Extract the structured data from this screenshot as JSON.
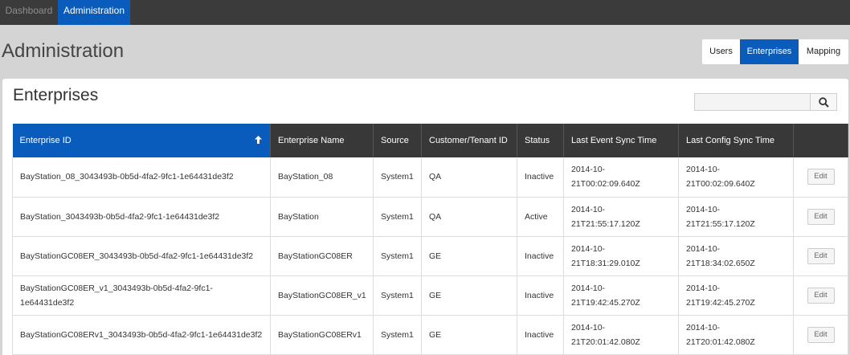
{
  "nav": {
    "tabs": [
      {
        "label": "Dashboard",
        "active": false
      },
      {
        "label": "Administration",
        "active": true
      }
    ]
  },
  "page": {
    "title": "Administration"
  },
  "view_switch": {
    "items": [
      {
        "label": "Users",
        "active": false
      },
      {
        "label": "Enterprises",
        "active": true
      },
      {
        "label": "Mapping",
        "active": false
      }
    ]
  },
  "card": {
    "title": "Enterprises",
    "search": {
      "value": "",
      "placeholder": ""
    }
  },
  "table": {
    "columns": [
      {
        "label": "Enterprise ID",
        "sorted": "ascending"
      },
      {
        "label": "Enterprise Name"
      },
      {
        "label": "Source"
      },
      {
        "label": "Customer/Tenant ID"
      },
      {
        "label": "Status"
      },
      {
        "label": "Last Event Sync Time"
      },
      {
        "label": "Last Config Sync Time"
      },
      {
        "label": ""
      }
    ],
    "edit_label": "Edit",
    "rows": [
      {
        "id": "BayStation_08_3043493b-0b5d-4fa2-9fc1-1e64431de3f2",
        "name": "BayStation_08",
        "source": "System1",
        "tenant": "QA",
        "status": "Inactive",
        "event_sync": "2014-10-21T00:02:09.640Z",
        "config_sync": "2014-10-21T00:02:09.640Z"
      },
      {
        "id": "BayStation_3043493b-0b5d-4fa2-9fc1-1e64431de3f2",
        "name": "BayStation",
        "source": "System1",
        "tenant": "QA",
        "status": "Active",
        "event_sync": "2014-10-21T21:55:17.120Z",
        "config_sync": "2014-10-21T21:55:17.120Z"
      },
      {
        "id": "BayStationGC08ER_3043493b-0b5d-4fa2-9fc1-1e64431de3f2",
        "name": "BayStationGC08ER",
        "source": "System1",
        "tenant": "GE",
        "status": "Inactive",
        "event_sync": "2014-10-21T18:31:29.010Z",
        "config_sync": "2014-10-21T18:34:02.650Z"
      },
      {
        "id": "BayStationGC08ER_v1_3043493b-0b5d-4fa2-9fc1-1e64431de3f2",
        "name": "BayStationGC08ER_v1",
        "source": "System1",
        "tenant": "GE",
        "status": "Inactive",
        "event_sync": "2014-10-21T19:42:45.270Z",
        "config_sync": "2014-10-21T19:42:45.270Z"
      },
      {
        "id": "BayStationGC08ERv1_3043493b-0b5d-4fa2-9fc1-1e64431de3f2",
        "name": "BayStationGC08ERv1",
        "source": "System1",
        "tenant": "GE",
        "status": "Inactive",
        "event_sync": "2014-10-21T20:01:42.080Z",
        "config_sync": "2014-10-21T20:01:42.080Z"
      }
    ]
  }
}
